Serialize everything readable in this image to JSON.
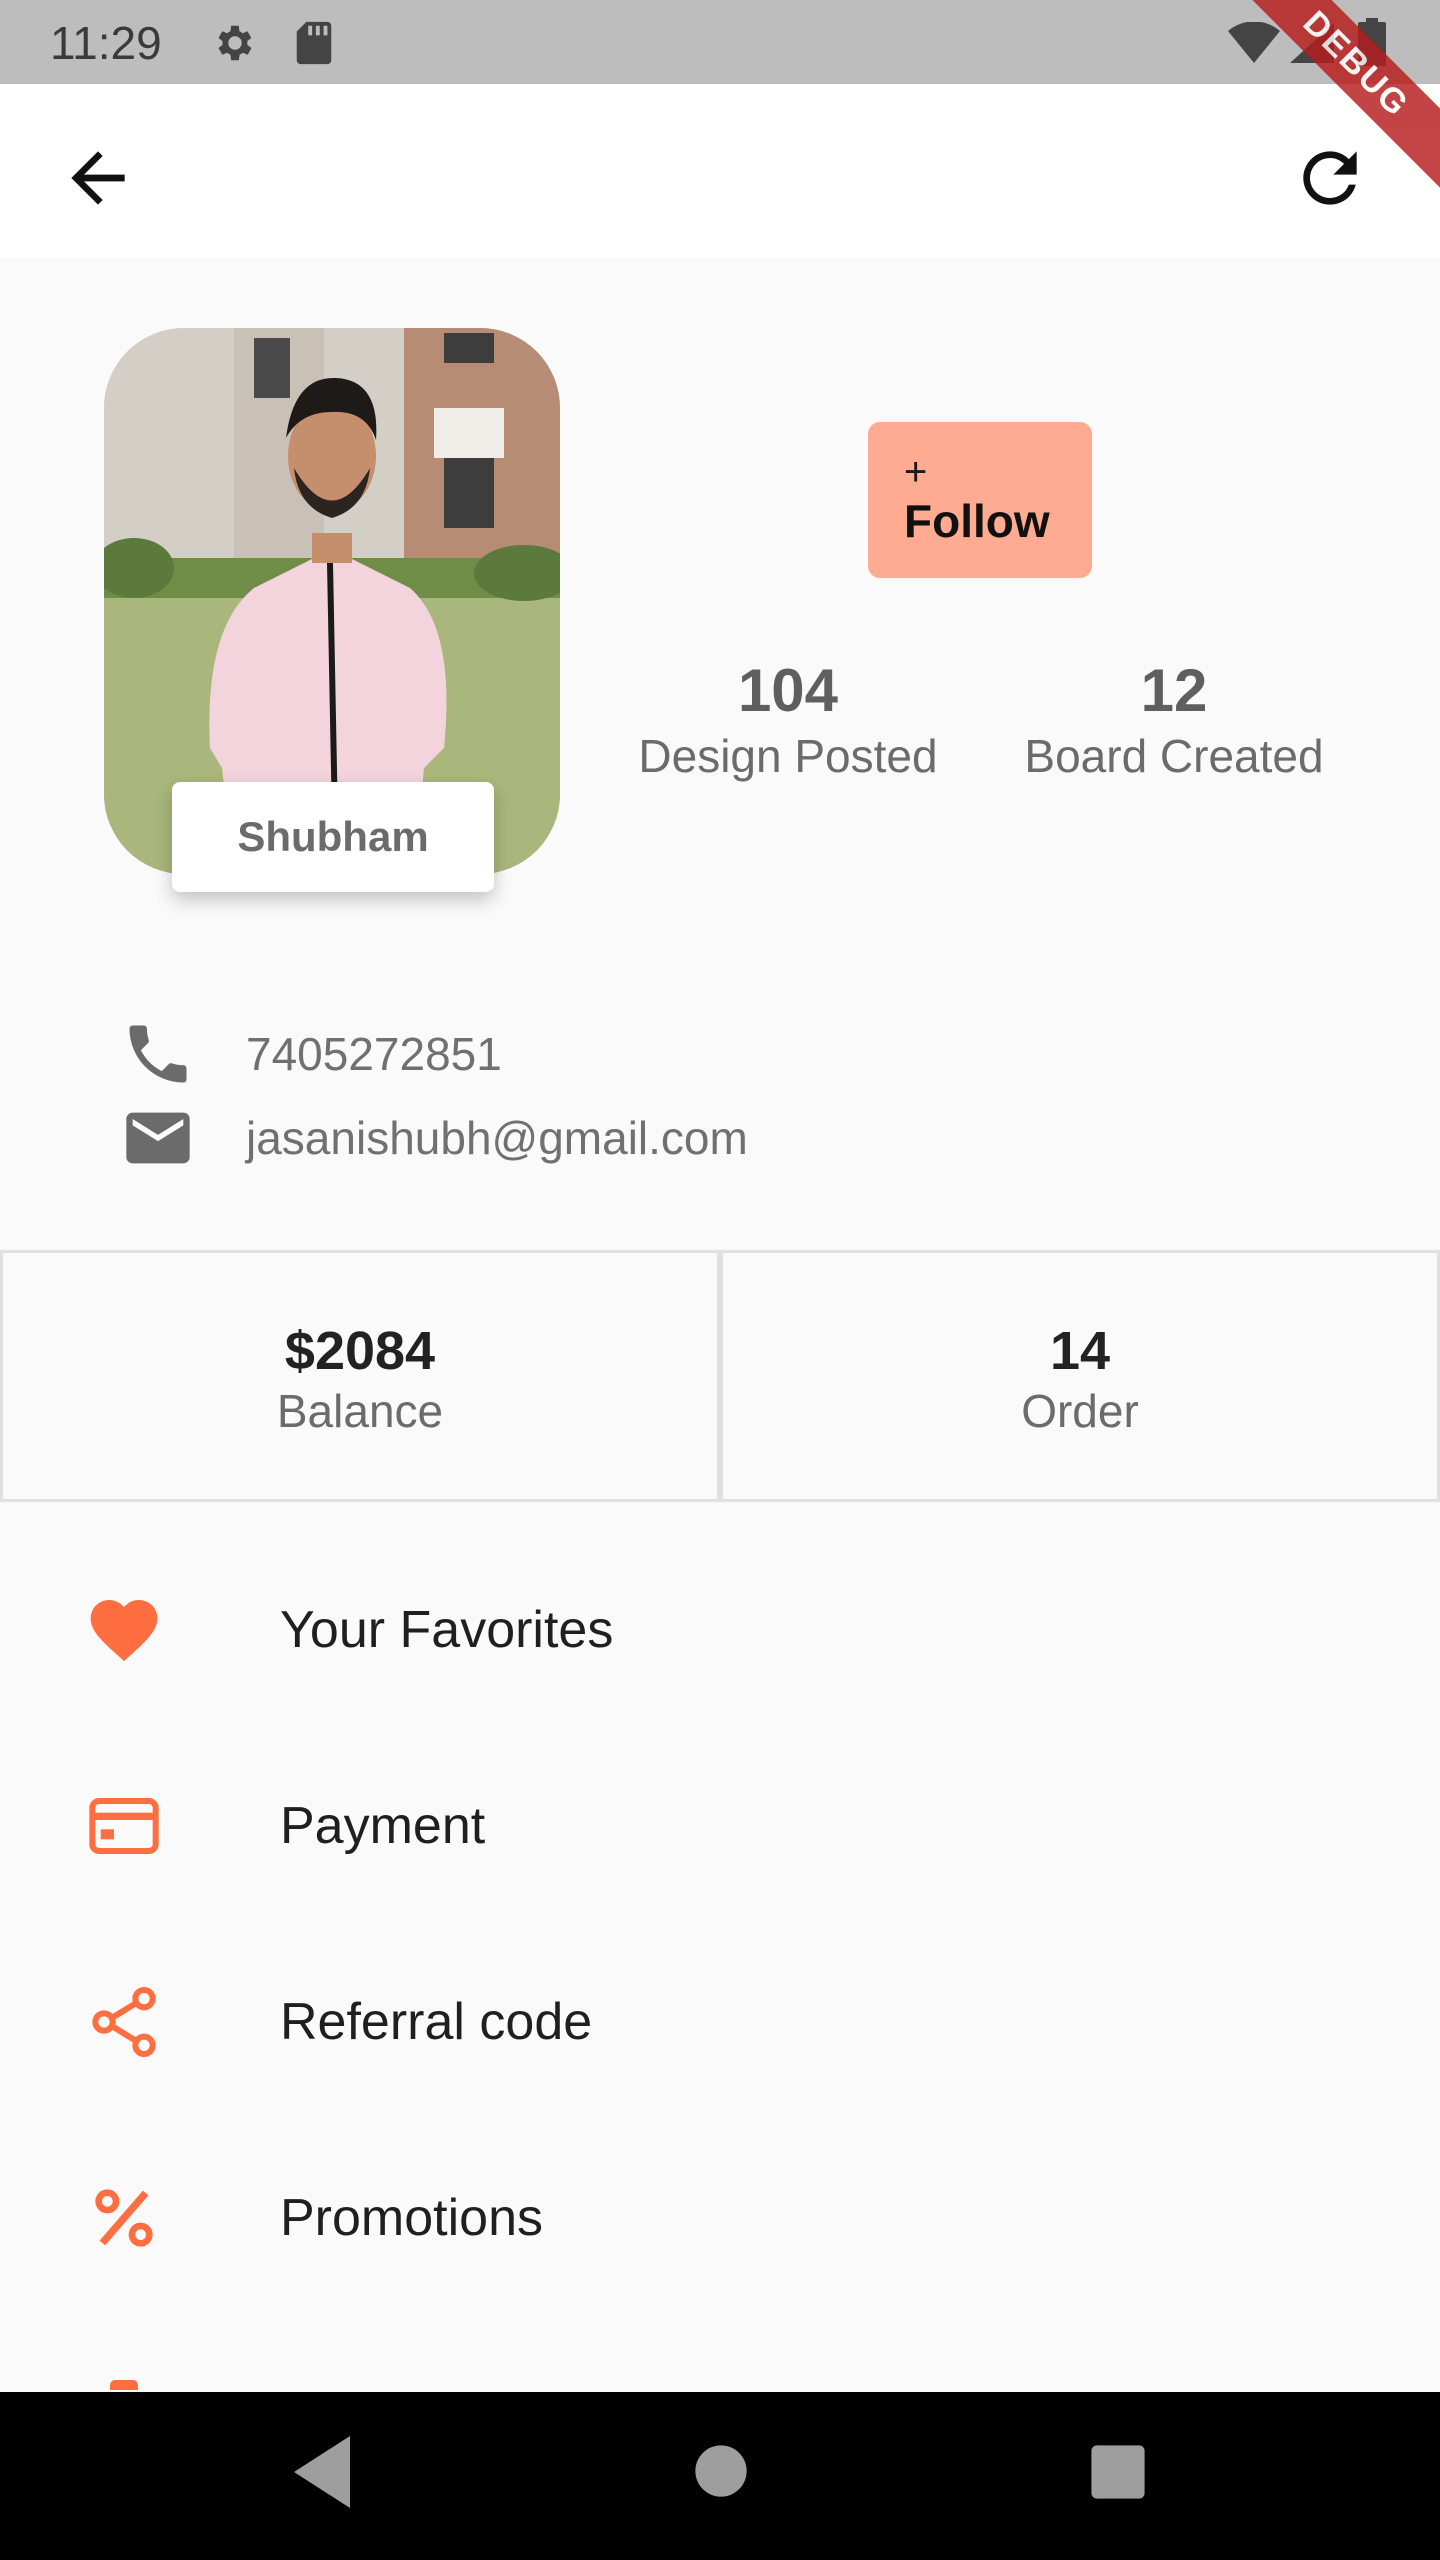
{
  "status_bar": {
    "time": "11:29",
    "icons": [
      "settings-icon",
      "sd-card-icon",
      "wifi-icon",
      "signal-icon",
      "battery-icon"
    ],
    "debug_banner": "DEBUG"
  },
  "app_bar": {
    "back_icon": "arrow-back-icon",
    "refresh_icon": "refresh-icon"
  },
  "profile": {
    "name": "Shubham",
    "follow_plus": "+",
    "follow_label": "Follow",
    "follow_color": "#ffab91",
    "stats": [
      {
        "value": "104",
        "label": "Design Posted"
      },
      {
        "value": "12",
        "label": "Board Created"
      }
    ]
  },
  "contact": {
    "phone": "7405272851",
    "email": "jasanishubh@gmail.com"
  },
  "summary": {
    "balance_value": "$2084",
    "balance_label": "Balance",
    "order_value": "14",
    "order_label": "Order"
  },
  "menu": {
    "accent_color": "#ff6e40",
    "items": [
      {
        "label": "Your Favorites",
        "icon": "heart-icon"
      },
      {
        "label": "Payment",
        "icon": "credit-card-icon"
      },
      {
        "label": "Referral code",
        "icon": "share-icon"
      },
      {
        "label": "Promotions",
        "icon": "percent-icon"
      }
    ]
  },
  "nav_bar": {
    "icons": [
      "back-triangle-icon",
      "home-circle-icon",
      "recents-square-icon"
    ]
  }
}
